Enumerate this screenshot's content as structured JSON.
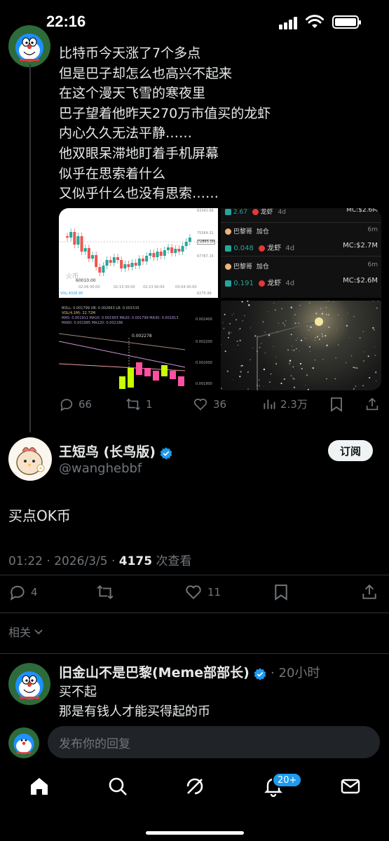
{
  "status_bar": {
    "time": "22:16"
  },
  "quoted_post": {
    "lines": [
      "比特币今天涨了7个多点",
      "但是巴子却怎么也高兴不起来",
      "在这个漫天飞雪的寒夜里",
      "巴子望着他昨天270万市值买的龙虾",
      "内心久久无法平静……",
      "他双眼呆滞地盯着手机屏幕",
      "似乎在思索着什么",
      "又似乎什么也没有思索……"
    ],
    "media": {
      "chart_panel": {
        "watermark": "火币",
        "low_label": "60010.00",
        "price_labels": [
          "83341.66",
          "75564.31",
          "72865.00",
          "67787.15",
          "6275.99"
        ],
        "date_labels": [
          "02-06 00:00",
          "02-15 00:00",
          "02-23 00:00",
          "03-04 00:00"
        ],
        "vol_label": "VOL:4326.95"
      },
      "trade_panel": {
        "rows": [
          {
            "name": "",
            "action": "",
            "amount": "2.67",
            "token": "龙虾",
            "age": "4d",
            "time": "",
            "mc": "MC:$2.6M"
          },
          {
            "name": "巴黎哥",
            "action": "加仓",
            "amount": "0.048",
            "token": "龙虾",
            "age": "4d",
            "time": "6m",
            "mc": "MC:$2.7M"
          },
          {
            "name": "巴黎哥",
            "action": "加仓",
            "amount": "0.191",
            "token": "龙虾",
            "age": "4d",
            "time": "6m",
            "mc": "MC:$2.6M"
          }
        ]
      },
      "indicator_panel": {
        "boll": "BOLL: 0.001799  UB: 0.002663  LB: 0.001535",
        "vol": "VOL(4.1M): 22.72M",
        "ma1": "MA5: 0.001911  MA10: 0.001903  MA20: 0.001799  MA30: 0.001813",
        "ma2": "MA60: 0.001985  MA120: 0.002188",
        "peak": "0.002278",
        "axis": [
          "0.002400",
          "0.002200",
          "0.002000",
          "0.001800"
        ]
      }
    },
    "actions": {
      "replies": "66",
      "reposts": "1",
      "likes": "36",
      "views": "2.3万"
    }
  },
  "main_post": {
    "display_name": "王短鸟 (长鸟版)",
    "handle": "@wanghebbf",
    "subscribe_label": "订阅",
    "text": "买点OK币",
    "time": "01:22 · 2026/3/5 · ",
    "views_count": "4175",
    "views_label": " 次查看",
    "actions": {
      "replies": "4",
      "likes": "11"
    }
  },
  "related_label": "相关",
  "reply": {
    "display_name": "旧金山不是巴黎(Meme部部长)",
    "time": "· 20小时",
    "lines": [
      "买不起",
      "那是有钱人才能买得起的币"
    ]
  },
  "compose": {
    "placeholder": "发布你的回复"
  },
  "tab_bar": {
    "notifications_badge": "20+"
  },
  "colors": {
    "accent": "#1d9bf0",
    "background": "#000000",
    "secondary_text": "#71767b",
    "up": "#26a69a",
    "down": "#ef5350"
  }
}
